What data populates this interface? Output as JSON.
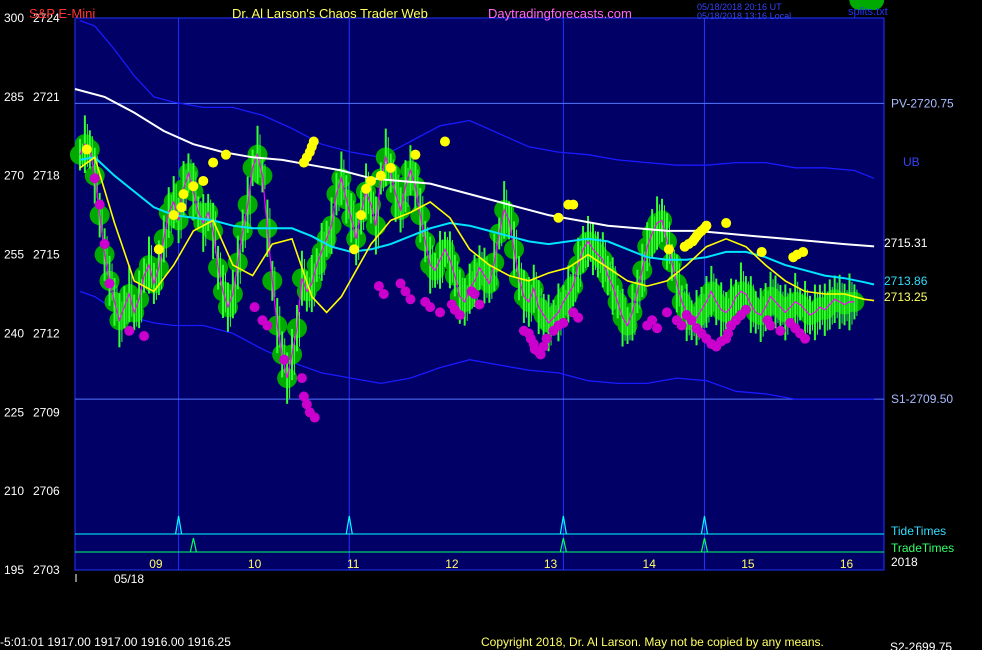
{
  "header": {
    "instrument": "S&P E-Mini",
    "site": "Dr. Al Larson's Chaos Trader Web",
    "url": "Daytradingforecasts.com",
    "time_utc": "05/18/2018 20:16 UT",
    "time_local": "05/18/2018 13:16 Local",
    "code": "splits.txt"
  },
  "footer": {
    "status": "-5:01:01  1917.00 1917.00 1916.00 1916.25",
    "copyright": "Copyright 2018, Dr. Al Larson. May not be copied by any means.",
    "right": "S2-2699.75"
  },
  "colors": {
    "plot_bg": "#000066",
    "frame": "#2233ff",
    "price_line": "#ff00ff",
    "halo": "#00aa00",
    "bars": "#33ff33",
    "fast_ma": "#ffff00",
    "mid_ma": "#00e5ff",
    "slow_ma": "#ffffff",
    "bands": "#1a1aff",
    "high_dots": "#ffff00",
    "low_dots": "#cc00cc",
    "tide": "#00ffff",
    "trade": "#00ff66"
  },
  "chart_data": {
    "type": "line",
    "ylim": [
      2703,
      2724
    ],
    "xlim": [
      8.0,
      16.2
    ],
    "y_ticks_left": [
      {
        "value": 2724,
        "label": "2724",
        "osc": "300"
      },
      {
        "value": 2721,
        "label": "2721",
        "osc": "285"
      },
      {
        "value": 2718,
        "label": "2718",
        "osc": "270"
      },
      {
        "value": 2715,
        "label": "2715",
        "osc": "255"
      },
      {
        "value": 2712,
        "label": "2712",
        "osc": "240"
      },
      {
        "value": 2709,
        "label": "2709",
        "osc": "225"
      },
      {
        "value": 2706,
        "label": "2706",
        "osc": "210"
      },
      {
        "value": 2703,
        "label": "2703",
        "osc": "195"
      }
    ],
    "x_ticks": [
      {
        "value": 8.8,
        "label": "09"
      },
      {
        "value": 9.8,
        "label": "10"
      },
      {
        "value": 10.8,
        "label": "11"
      },
      {
        "value": 11.8,
        "label": "12"
      },
      {
        "value": 12.8,
        "label": "13"
      },
      {
        "value": 13.8,
        "label": "14"
      },
      {
        "value": 14.8,
        "label": "15"
      },
      {
        "value": 15.8,
        "label": "16"
      }
    ],
    "date_label": "05/18",
    "year_label": "2018",
    "hlines": [
      {
        "value": 2720.75,
        "label": "PV-2720.75"
      },
      {
        "value": 2709.5,
        "label": "S1-2709.50"
      }
    ],
    "band_label": "UB",
    "last_values": [
      {
        "value": 2715.31,
        "label": "2715.31",
        "series": "slow_ma"
      },
      {
        "value": 2713.86,
        "label": "2713.86",
        "series": "mid_ma"
      },
      {
        "value": 2713.25,
        "label": "2713.25",
        "series": "fast_ma"
      }
    ],
    "vlines": [
      9.05,
      10.78,
      12.95,
      14.38
    ],
    "tide_label": "TideTimes",
    "trade_label": "TradeTimes",
    "tide_times": [
      9.05,
      10.78,
      12.95,
      14.38
    ],
    "trade_times": [
      9.2,
      12.95,
      14.38
    ],
    "series": {
      "price": {
        "x": [
          8.05,
          8.1,
          8.15,
          8.2,
          8.25,
          8.3,
          8.35,
          8.4,
          8.45,
          8.5,
          8.55,
          8.6,
          8.65,
          8.7,
          8.75,
          8.8,
          8.85,
          8.9,
          8.95,
          9.0,
          9.05,
          9.1,
          9.15,
          9.2,
          9.25,
          9.3,
          9.35,
          9.4,
          9.45,
          9.5,
          9.55,
          9.6,
          9.65,
          9.7,
          9.75,
          9.8,
          9.85,
          9.9,
          9.95,
          10.0,
          10.05,
          10.1,
          10.15,
          10.2,
          10.25,
          10.3,
          10.35,
          10.4,
          10.45,
          10.5,
          10.55,
          10.6,
          10.65,
          10.7,
          10.75,
          10.8,
          10.85,
          10.9,
          10.95,
          11.0,
          11.05,
          11.1,
          11.15,
          11.2,
          11.25,
          11.3,
          11.35,
          11.4,
          11.45,
          11.5,
          11.55,
          11.6,
          11.65,
          11.7,
          11.75,
          11.8,
          11.85,
          11.9,
          11.95,
          12.0,
          12.05,
          12.1,
          12.15,
          12.2,
          12.25,
          12.3,
          12.35,
          12.4,
          12.45,
          12.5,
          12.55,
          12.6,
          12.65,
          12.7,
          12.75,
          12.8,
          12.85,
          12.9,
          12.95,
          13.0,
          13.05,
          13.1,
          13.15,
          13.2,
          13.25,
          13.3,
          13.35,
          13.4,
          13.45,
          13.5,
          13.55,
          13.6,
          13.65,
          13.7,
          13.75,
          13.8,
          13.85,
          13.9,
          13.95,
          14.0,
          14.05,
          14.1,
          14.15,
          14.2,
          14.25,
          14.3,
          14.35,
          14.4,
          14.45,
          14.5,
          14.55,
          14.6,
          14.65,
          14.7,
          14.75,
          14.8,
          14.85,
          14.9,
          14.95,
          15.0,
          15.05,
          15.1,
          15.15,
          15.2,
          15.25,
          15.3,
          15.35,
          15.4,
          15.45,
          15.5,
          15.55,
          15.6,
          15.65,
          15.7,
          15.75,
          15.8,
          15.85,
          15.9,
          15.95,
          16.0,
          16.05,
          16.1
        ],
        "y": [
          2718.8,
          2719.2,
          2719.0,
          2718.0,
          2716.5,
          2715.0,
          2714.0,
          2713.2,
          2712.5,
          2713.0,
          2713.5,
          2712.8,
          2713.3,
          2714.2,
          2714.6,
          2713.9,
          2714.5,
          2715.6,
          2716.6,
          2717.0,
          2716.3,
          2717.5,
          2718.1,
          2717.4,
          2716.6,
          2716.2,
          2716.6,
          2715.9,
          2714.5,
          2713.6,
          2713.0,
          2713.5,
          2714.7,
          2715.9,
          2716.9,
          2718.3,
          2718.8,
          2718.0,
          2716.0,
          2714.0,
          2712.3,
          2711.2,
          2710.3,
          2711.2,
          2712.2,
          2714.1,
          2713.6,
          2713.9,
          2714.6,
          2715.1,
          2715.6,
          2716.1,
          2717.3,
          2717.9,
          2717.1,
          2716.4,
          2715.6,
          2716.6,
          2717.4,
          2716.9,
          2716.1,
          2717.9,
          2718.7,
          2718.1,
          2717.3,
          2716.7,
          2717.6,
          2718.2,
          2717.6,
          2716.5,
          2715.5,
          2714.6,
          2714.4,
          2714.8,
          2715.2,
          2714.8,
          2714.2,
          2713.4,
          2713.2,
          2713.7,
          2714.0,
          2714.5,
          2714.2,
          2713.9,
          2714.7,
          2715.8,
          2716.7,
          2716.3,
          2715.2,
          2714.1,
          2713.4,
          2713.2,
          2713.7,
          2713.0,
          2712.7,
          2712.4,
          2712.6,
          2712.8,
          2713.2,
          2713.5,
          2713.8,
          2714.6,
          2715.2,
          2715.5,
          2715.2,
          2715.0,
          2714.8,
          2714.2,
          2713.8,
          2713.2,
          2712.6,
          2712.3,
          2712.8,
          2713.6,
          2714.4,
          2715.3,
          2715.8,
          2716.2,
          2716.3,
          2715.5,
          2714.7,
          2713.9,
          2713.2,
          2712.8,
          2712.5,
          2712.6,
          2712.9,
          2713.2,
          2713.6,
          2713.2,
          2712.9,
          2712.8,
          2713.0,
          2713.4,
          2713.6,
          2713.5,
          2713.1,
          2712.8,
          2712.7,
          2713.0,
          2713.4,
          2713.2,
          2713.0,
          2712.8,
          2713.0,
          2713.2,
          2713.1,
          2712.9,
          2712.7,
          2712.8,
          2713.0,
          2712.9,
          2713.1,
          2713.3,
          2713.2,
          2713.1,
          2713.2,
          2713.2
        ],
        "note_text": ""
      },
      "fast_ma": {
        "x": [
          8.05,
          8.2,
          8.4,
          8.6,
          8.8,
          9.0,
          9.2,
          9.4,
          9.6,
          9.8,
          10.0,
          10.2,
          10.4,
          10.55,
          10.7,
          10.85,
          11.0,
          11.2,
          11.4,
          11.6,
          11.8,
          12.0,
          12.2,
          12.4,
          12.6,
          12.8,
          13.0,
          13.2,
          13.4,
          13.6,
          13.8,
          14.0,
          14.2,
          14.4,
          14.6,
          14.8,
          15.0,
          15.2,
          15.4,
          15.6,
          15.8,
          16.0,
          16.1
        ],
        "y": [
          2718.3,
          2718.7,
          2716.2,
          2714.0,
          2713.6,
          2714.6,
          2715.9,
          2716.3,
          2714.6,
          2714.2,
          2715.4,
          2715.6,
          2713.4,
          2712.8,
          2713.4,
          2714.4,
          2715.4,
          2716.3,
          2716.6,
          2717.0,
          2716.4,
          2715.2,
          2714.6,
          2714.2,
          2714.0,
          2714.3,
          2714.5,
          2715.0,
          2714.5,
          2714.0,
          2713.8,
          2714.0,
          2714.6,
          2715.3,
          2715.6,
          2715.3,
          2714.6,
          2714.0,
          2713.6,
          2713.5,
          2713.5,
          2713.3,
          2713.25
        ]
      },
      "mid_ma": {
        "x": [
          8.05,
          8.2,
          8.4,
          8.6,
          8.8,
          9.0,
          9.2,
          9.4,
          9.6,
          9.8,
          10.0,
          10.2,
          10.4,
          10.6,
          10.8,
          11.0,
          11.2,
          11.4,
          11.6,
          11.8,
          12.0,
          12.2,
          12.4,
          12.6,
          12.8,
          13.0,
          13.2,
          13.4,
          13.6,
          13.8,
          14.0,
          14.2,
          14.4,
          14.6,
          14.8,
          15.0,
          15.2,
          15.4,
          15.6,
          15.8,
          16.0,
          16.1
        ],
        "y": [
          2718.6,
          2718.7,
          2718.0,
          2717.4,
          2716.8,
          2716.5,
          2716.4,
          2716.3,
          2716.1,
          2716.0,
          2716.0,
          2716.0,
          2715.7,
          2715.3,
          2715.1,
          2715.2,
          2715.4,
          2715.7,
          2716.0,
          2716.2,
          2716.1,
          2715.9,
          2715.7,
          2715.5,
          2715.4,
          2715.5,
          2715.6,
          2715.5,
          2715.2,
          2714.9,
          2714.8,
          2714.8,
          2714.9,
          2715.1,
          2715.1,
          2714.9,
          2714.6,
          2714.4,
          2714.2,
          2714.1,
          2713.95,
          2713.86
        ]
      },
      "slow_ma": {
        "x": [
          8.0,
          8.3,
          8.6,
          8.9,
          9.2,
          9.5,
          9.8,
          10.1,
          10.4,
          10.7,
          11.0,
          11.3,
          11.6,
          11.9,
          12.2,
          12.5,
          12.8,
          13.1,
          13.4,
          13.7,
          14.0,
          14.3,
          14.6,
          14.9,
          15.2,
          15.5,
          15.8,
          16.1
        ],
        "y": [
          2721.3,
          2721.0,
          2720.4,
          2719.7,
          2719.2,
          2718.9,
          2718.7,
          2718.6,
          2718.4,
          2718.2,
          2717.9,
          2717.8,
          2717.7,
          2717.4,
          2717.1,
          2716.8,
          2716.5,
          2716.3,
          2716.1,
          2716.0,
          2715.9,
          2715.9,
          2715.8,
          2715.7,
          2715.6,
          2715.5,
          2715.4,
          2715.31
        ]
      },
      "upper_band": {
        "x": [
          8.05,
          8.2,
          8.4,
          8.6,
          8.8,
          9.0,
          9.3,
          9.6,
          9.9,
          10.2,
          10.5,
          10.8,
          11.1,
          11.4,
          11.7,
          12.0,
          12.3,
          12.6,
          12.9,
          13.2,
          13.5,
          13.8,
          14.1,
          14.4,
          14.7,
          15.0,
          15.3,
          15.6,
          15.9,
          16.1
        ],
        "y": [
          2723.9,
          2723.7,
          2722.8,
          2721.8,
          2721.0,
          2720.8,
          2720.6,
          2720.6,
          2720.3,
          2719.8,
          2719.2,
          2718.9,
          2718.7,
          2719.3,
          2719.9,
          2720.1,
          2719.6,
          2719.1,
          2718.9,
          2718.8,
          2718.6,
          2718.5,
          2718.4,
          2718.4,
          2718.5,
          2718.5,
          2718.3,
          2718.3,
          2718.2,
          2717.9
        ]
      },
      "lower_band": {
        "x": [
          8.05,
          8.2,
          8.4,
          8.6,
          8.8,
          9.0,
          9.3,
          9.6,
          9.9,
          10.2,
          10.5,
          10.8,
          11.1,
          11.4,
          11.7,
          12.0,
          12.3,
          12.6,
          12.9,
          13.2,
          13.5,
          13.8,
          14.1,
          14.4,
          14.7,
          15.0,
          15.3,
          15.6,
          15.9,
          16.1
        ],
        "y": [
          2713.6,
          2713.4,
          2712.9,
          2712.6,
          2712.4,
          2712.3,
          2712.3,
          2712.0,
          2711.4,
          2710.9,
          2710.5,
          2710.3,
          2710.1,
          2710.3,
          2710.7,
          2711.0,
          2710.8,
          2710.6,
          2710.5,
          2710.2,
          2710.1,
          2710.1,
          2710.3,
          2710.2,
          2709.8,
          2709.7,
          2709.5,
          2709.5,
          2709.5,
          2709.5
        ]
      },
      "high_dots": {
        "x": [
          8.12,
          8.85,
          9.0,
          9.08,
          9.1,
          9.2,
          9.3,
          9.4,
          9.53,
          10.32,
          10.35,
          10.38,
          10.4,
          10.42,
          10.83,
          10.9,
          10.95,
          11.0,
          11.1,
          11.2,
          11.45,
          11.75,
          12.9,
          13.0,
          13.05,
          14.02,
          14.18,
          14.22,
          14.26,
          14.28,
          14.3,
          14.32,
          14.35,
          14.38,
          14.4,
          14.6,
          14.96,
          15.28,
          15.32,
          15.38
        ],
        "y": [
          2719.0,
          2715.2,
          2716.5,
          2716.8,
          2717.3,
          2717.6,
          2717.8,
          2718.5,
          2718.8,
          2718.5,
          2718.7,
          2718.9,
          2719.1,
          2719.3,
          2715.2,
          2716.5,
          2717.5,
          2717.8,
          2718.0,
          2718.3,
          2718.8,
          2719.3,
          2716.4,
          2716.9,
          2716.9,
          2715.2,
          2715.3,
          2715.4,
          2715.5,
          2715.6,
          2715.7,
          2715.8,
          2715.9,
          2716.0,
          2716.1,
          2716.2,
          2715.1,
          2714.9,
          2715.0,
          2715.1
        ]
      },
      "low_dots": {
        "x": [
          8.2,
          8.25,
          8.3,
          8.35,
          8.55,
          8.7,
          9.82,
          9.9,
          9.95,
          10.12,
          10.3,
          10.32,
          10.35,
          10.38,
          10.43,
          11.08,
          11.13,
          11.3,
          11.35,
          11.4,
          11.55,
          11.6,
          11.7,
          11.82,
          11.85,
          11.9,
          12.02,
          12.05,
          12.1,
          12.55,
          12.6,
          12.62,
          12.65,
          12.66,
          12.7,
          12.72,
          12.75,
          12.78,
          12.85,
          12.9,
          12.95,
          13.05,
          13.1,
          13.8,
          13.85,
          13.9,
          14.0,
          14.1,
          14.15,
          14.2,
          14.25,
          14.3,
          14.35,
          14.4,
          14.45,
          14.5,
          14.55,
          14.6,
          14.62,
          14.65,
          14.7,
          14.75,
          14.8,
          15.02,
          15.05,
          15.15,
          15.25,
          15.3,
          15.35,
          15.4
        ],
        "y": [
          2717.9,
          2716.9,
          2715.4,
          2713.9,
          2712.1,
          2711.9,
          2713.0,
          2712.5,
          2712.3,
          2711.0,
          2710.3,
          2709.6,
          2709.3,
          2709.0,
          2708.8,
          2713.8,
          2713.5,
          2713.9,
          2713.6,
          2713.3,
          2713.2,
          2713.0,
          2712.8,
          2713.1,
          2712.9,
          2712.7,
          2713.6,
          2713.5,
          2713.1,
          2712.1,
          2712.0,
          2711.8,
          2711.6,
          2711.4,
          2711.3,
          2711.2,
          2711.5,
          2711.8,
          2712.1,
          2712.3,
          2712.4,
          2712.8,
          2712.6,
          2712.3,
          2712.5,
          2712.2,
          2712.8,
          2712.5,
          2712.3,
          2712.7,
          2712.5,
          2712.2,
          2712.0,
          2711.8,
          2711.6,
          2711.5,
          2711.7,
          2711.8,
          2712.0,
          2712.3,
          2712.5,
          2712.7,
          2712.9,
          2712.5,
          2712.3,
          2712.1,
          2712.4,
          2712.2,
          2712.0,
          2711.8
        ]
      }
    }
  }
}
